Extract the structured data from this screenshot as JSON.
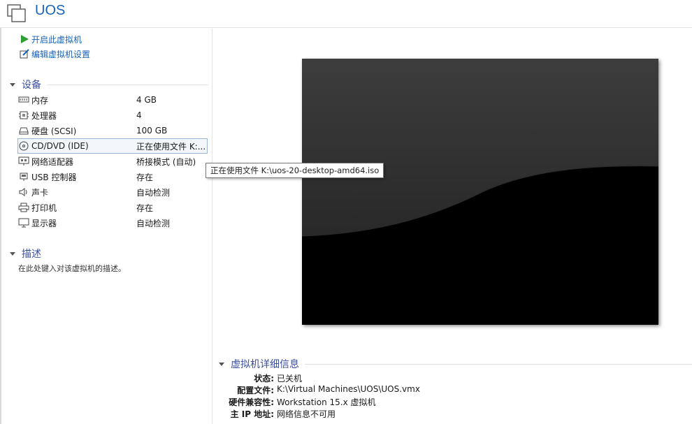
{
  "header": {
    "title": "UOS"
  },
  "actions": [
    {
      "label": "开启此虚拟机",
      "icon": "play-icon"
    },
    {
      "label": "编辑虚拟机设置",
      "icon": "edit-settings-icon"
    }
  ],
  "devices_section": {
    "title": "设备",
    "items": [
      {
        "name": "内存",
        "value": "4 GB",
        "icon": "memory-icon"
      },
      {
        "name": "处理器",
        "value": "4",
        "icon": "processor-icon"
      },
      {
        "name": "硬盘 (SCSI)",
        "value": "100 GB",
        "icon": "harddisk-icon"
      },
      {
        "name": "CD/DVD (IDE)",
        "value": "正在使用文件 K:...",
        "icon": "cd-dvd-icon"
      },
      {
        "name": "网络适配器",
        "value": "桥接模式 (自动)",
        "icon": "network-adapter-icon"
      },
      {
        "name": "USB 控制器",
        "value": "存在",
        "icon": "usb-icon"
      },
      {
        "name": "声卡",
        "value": "自动检测",
        "icon": "sound-card-icon"
      },
      {
        "name": "打印机",
        "value": "存在",
        "icon": "printer-icon"
      },
      {
        "name": "显示器",
        "value": "自动检测",
        "icon": "display-icon"
      }
    ]
  },
  "description_section": {
    "title": "描述",
    "placeholder": "在此处键入对该虚拟机的描述。"
  },
  "tooltip": {
    "text": "正在使用文件 K:\\uos-20-desktop-amd64.iso"
  },
  "details_section": {
    "title": "虚拟机详细信息",
    "rows": [
      {
        "key": "状态:",
        "value": "已关机"
      },
      {
        "key": "配置文件:",
        "value": "K:\\Virtual Machines\\UOS\\UOS.vmx"
      },
      {
        "key": "硬件兼容性:",
        "value": "Workstation 15.x 虚拟机"
      },
      {
        "key": "主 IP 地址:",
        "value": "网络信息不可用"
      }
    ]
  },
  "colors": {
    "accent": "#1a62b8",
    "section": "#3a4fa0",
    "play": "#2e9e2e"
  }
}
